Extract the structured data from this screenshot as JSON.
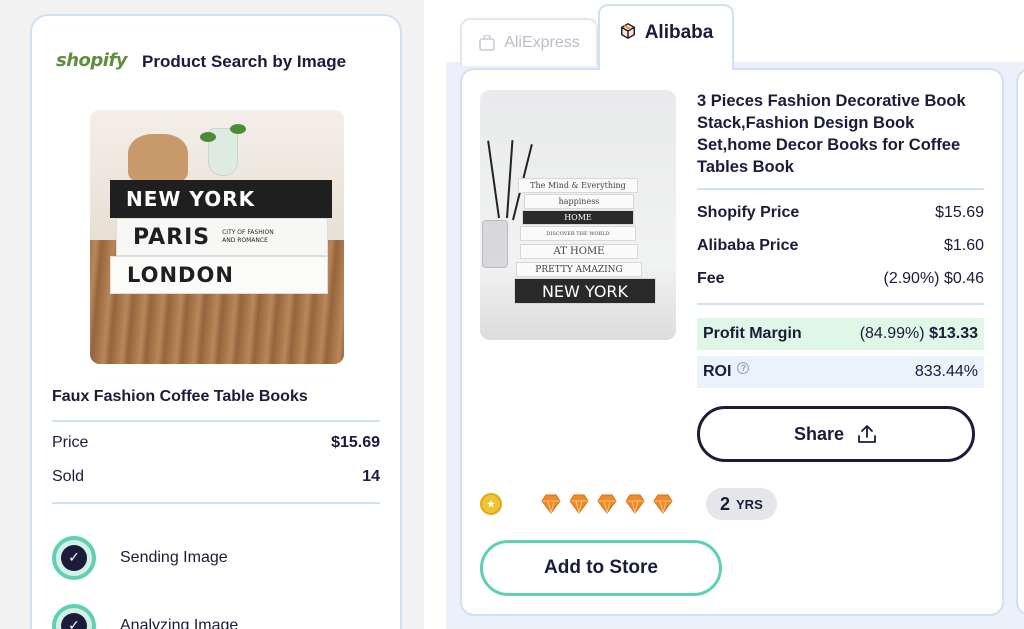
{
  "left": {
    "brand": "shopify",
    "title": "Product Search by Image",
    "product_image": {
      "books": [
        "NEW YORK",
        "PARIS",
        "LONDON"
      ],
      "paris_subtitle": "CITY OF FASHION AND ROMANCE"
    },
    "product_name": "Faux Fashion Coffee Table Books",
    "stats": [
      {
        "label": "Price",
        "value": "$15.69"
      },
      {
        "label": "Sold",
        "value": "14"
      }
    ],
    "steps": [
      {
        "label": "Sending Image",
        "icon": "check-icon"
      },
      {
        "label": "Analyzing Image",
        "icon": "check-icon"
      }
    ]
  },
  "tabs": [
    {
      "label": "AliExpress",
      "icon": "aliexpress-icon",
      "active": false
    },
    {
      "label": "Alibaba",
      "icon": "alibaba-icon",
      "active": true
    }
  ],
  "result": {
    "title": "3 Pieces Fashion Decorative Book Stack,Fashion Design Book Set,home Decor Books for Coffee Tables Book",
    "image_books": [
      "The Mind & Everything",
      "happiness",
      "HOME",
      "DISCOVER THE WORLD",
      "AT HOME",
      "PRETTY AMAZING",
      "NEW YORK"
    ],
    "prices": [
      {
        "label": "Shopify Price",
        "value": "$15.69"
      },
      {
        "label": "Alibaba Price",
        "value": "$1.60"
      },
      {
        "label": "Fee",
        "value": "(2.90%) $0.46"
      }
    ],
    "profit": {
      "label": "Profit Margin",
      "pct": "(84.99%)",
      "value": "$13.33"
    },
    "roi": {
      "label": "ROI",
      "value": "833.44%"
    },
    "share_label": "Share",
    "diamond_count": 5,
    "years": {
      "number": "2",
      "unit": "YRS"
    },
    "add_label": "Add to Store"
  },
  "colors": {
    "accent_teal": "#5fd0b2",
    "navy": "#1b1b3a",
    "border_blue": "#cfe0f7",
    "profit_green": "#dff7e6",
    "diamond_orange": "#f08a24",
    "shopify_green": "#5e8e3e"
  }
}
